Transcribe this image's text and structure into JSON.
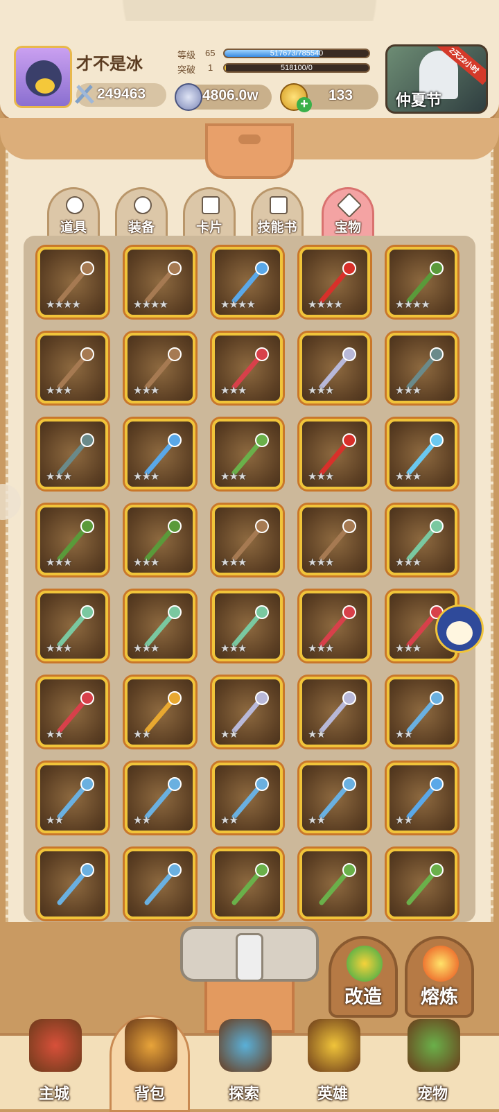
{
  "player": {
    "name": "才不是冰",
    "level": "65",
    "power": "249463",
    "level_label": "等级",
    "level_value": "65",
    "level_progress_text": "517673/785540",
    "level_progress": 0.659,
    "break_label": "突破",
    "break_value": "1",
    "break_progress_text": "518100/0",
    "break_progress": 0.01
  },
  "currency": {
    "silver": "4806.0w",
    "gold": "133"
  },
  "event": {
    "name": "仲夏节",
    "timer": "2天22小时"
  },
  "tabs": [
    {
      "label": "道具",
      "active": false
    },
    {
      "label": "装备",
      "active": false
    },
    {
      "label": "卡片",
      "active": false
    },
    {
      "label": "技能书",
      "active": false
    },
    {
      "label": "宝物",
      "active": true
    }
  ],
  "treasures": [
    {
      "icon": "branch-staff-icon",
      "color": "#a67a52",
      "stars": "★★★★"
    },
    {
      "icon": "branch-staff-icon",
      "color": "#a67a52",
      "stars": "★★★★"
    },
    {
      "icon": "crystal-staff-icon",
      "color": "#5aa8e8",
      "stars": "★★★★"
    },
    {
      "icon": "fire-staff-icon",
      "color": "#d8302a",
      "stars": "★★★★"
    },
    {
      "icon": "serpent-bow-icon",
      "color": "#5a9a3a",
      "stars": "★★★★"
    },
    {
      "icon": "branch-staff-icon",
      "color": "#a67a52",
      "stars": "★★★"
    },
    {
      "icon": "branch-staff-icon",
      "color": "#a67a52",
      "stars": "★★★"
    },
    {
      "icon": "red-dagger-icon",
      "color": "#d8404a",
      "stars": "★★★"
    },
    {
      "icon": "silver-sword-icon",
      "color": "#b8b8d8",
      "stars": "★★★"
    },
    {
      "icon": "thorn-mace-icon",
      "color": "#6a8a8a",
      "stars": "★★★"
    },
    {
      "icon": "thorn-mace-icon",
      "color": "#6a8a8a",
      "stars": "★★★"
    },
    {
      "icon": "crystal-staff-icon",
      "color": "#5aa8e8",
      "stars": "★★★"
    },
    {
      "icon": "leaf-staff-icon",
      "color": "#6ab04a",
      "stars": "★★★"
    },
    {
      "icon": "fire-staff-icon",
      "color": "#d8302a",
      "stars": "★★★"
    },
    {
      "icon": "ice-spear-icon",
      "color": "#6ac8f0",
      "stars": "★★★"
    },
    {
      "icon": "serpent-bow-icon",
      "color": "#5a9a3a",
      "stars": "★★★"
    },
    {
      "icon": "serpent-bow-icon",
      "color": "#5a9a3a",
      "stars": "★★★"
    },
    {
      "icon": "branch-staff-icon",
      "color": "#a67a52",
      "stars": "★★★"
    },
    {
      "icon": "branch-staff-icon",
      "color": "#a67a52",
      "stars": "★★★"
    },
    {
      "icon": "jade-sword-icon",
      "color": "#7ac8a0",
      "stars": "★★★"
    },
    {
      "icon": "jade-sword-icon",
      "color": "#7ac8a0",
      "stars": "★★★"
    },
    {
      "icon": "jade-sword-icon",
      "color": "#7ac8a0",
      "stars": "★★★"
    },
    {
      "icon": "jade-sword-icon",
      "color": "#7ac8a0",
      "stars": "★★★"
    },
    {
      "icon": "red-dagger-icon",
      "color": "#d8404a",
      "stars": "★★★"
    },
    {
      "icon": "red-dagger-icon",
      "color": "#d8404a",
      "stars": "★★★"
    },
    {
      "icon": "red-dagger-icon",
      "color": "#d8404a",
      "stars": "★★"
    },
    {
      "icon": "gold-shield-icon",
      "color": "#e8a830",
      "stars": "★★"
    },
    {
      "icon": "silver-sword-icon",
      "color": "#b8b8d8",
      "stars": "★★"
    },
    {
      "icon": "silver-sword-icon",
      "color": "#b8b8d8",
      "stars": "★★"
    },
    {
      "icon": "trident-icon",
      "color": "#6ab0e0",
      "stars": "★★"
    },
    {
      "icon": "trident-icon",
      "color": "#6ab0e0",
      "stars": "★★"
    },
    {
      "icon": "trident-icon",
      "color": "#6ab0e0",
      "stars": "★★"
    },
    {
      "icon": "trident-icon",
      "color": "#6ab0e0",
      "stars": "★★"
    },
    {
      "icon": "trident-icon",
      "color": "#6ab0e0",
      "stars": "★★"
    },
    {
      "icon": "crystal-staff-icon",
      "color": "#5aa8e8",
      "stars": "★★"
    },
    {
      "icon": "trident-icon",
      "color": "#6ab0e0",
      "stars": ""
    },
    {
      "icon": "trident-icon",
      "color": "#6ab0e0",
      "stars": ""
    },
    {
      "icon": "leaf-staff-icon",
      "color": "#6ab04a",
      "stars": ""
    },
    {
      "icon": "leaf-staff-icon",
      "color": "#6ab04a",
      "stars": ""
    },
    {
      "icon": "leaf-staff-icon",
      "color": "#6ab04a",
      "stars": ""
    }
  ],
  "actions": {
    "reforge": "改造",
    "smelt": "熔炼"
  },
  "nav": [
    {
      "label": "主城",
      "icon": "castle-icon",
      "active": false
    },
    {
      "label": "背包",
      "icon": "backpack-icon",
      "active": true
    },
    {
      "label": "探索",
      "icon": "map-icon",
      "active": false
    },
    {
      "label": "英雄",
      "icon": "hero-icon",
      "active": false
    },
    {
      "label": "宠物",
      "icon": "pet-icon",
      "active": false
    }
  ],
  "colors": {
    "slot_border": "#f0c43a",
    "active_tab": "#f4a3a3",
    "background": "#f4e7cf"
  }
}
